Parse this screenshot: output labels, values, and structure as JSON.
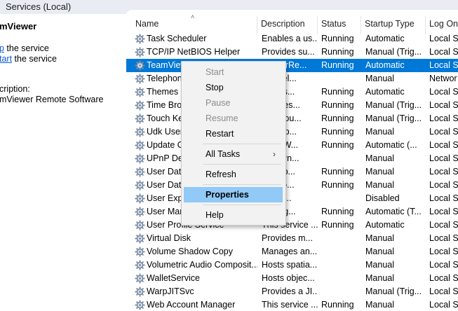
{
  "window": {
    "title": "Services (Local)"
  },
  "left_pane": {
    "service_name": "mViewer",
    "action_stop_link": "p",
    "action_stop_suffix": " the service",
    "action_restart_link": "tart",
    "action_restart_suffix": " the service",
    "description_label": "cription:",
    "description_text": "mViewer Remote Software"
  },
  "columns": {
    "name": "Name",
    "description": "Description",
    "status": "Status",
    "startup_type": "Startup Type",
    "log_on": "Log On"
  },
  "services": [
    {
      "name": "Task Scheduler",
      "description": "Enables a us...",
      "status": "Running",
      "startup": "Automatic",
      "logon": "Local Sy"
    },
    {
      "name": "TCP/IP NetBIOS Helper",
      "description": "Provides su...",
      "status": "Running",
      "startup": "Manual (Trig...",
      "logon": "Local Se"
    },
    {
      "name": "TeamViewer",
      "description": "ViewerRe...",
      "status": "Running",
      "startup": "Automatic",
      "logon": "Local Sy"
    },
    {
      "name": "Telephony",
      "description": "des Tel...",
      "status": "",
      "startup": "Manual",
      "logon": "Networ"
    },
    {
      "name": "Themes",
      "description": "des us...",
      "status": "Running",
      "startup": "Automatic",
      "logon": "Local Sy"
    },
    {
      "name": "Time Broker",
      "description": "rdinates...",
      "status": "Running",
      "startup": "Manual (Trig...",
      "logon": "Local Se"
    },
    {
      "name": "Touch Keyboard",
      "description": "bles Tou...",
      "status": "Running",
      "startup": "Manual (Trig...",
      "logon": "Local Sy"
    },
    {
      "name": "Udk User Service",
      "description": "ll comp...",
      "status": "Running",
      "startup": "Manual",
      "logon": "Local Sy"
    },
    {
      "name": "Update Orchestrator",
      "description": "ages W...",
      "status": "Running",
      "startup": "Automatic (...",
      "logon": "Local Sy"
    },
    {
      "name": "UPnP Device Host",
      "description": "ws UPn...",
      "status": "",
      "startup": "Manual",
      "logon": "Local Se"
    },
    {
      "name": "User Data Access",
      "description": "des ap...",
      "status": "Running",
      "startup": "Manual",
      "logon": "Local Sy"
    },
    {
      "name": "User Data Storage",
      "description": "les sto...",
      "status": "Running",
      "startup": "Manual",
      "logon": "Local Sy"
    },
    {
      "name": "User Experience",
      "description": "ort for...",
      "status": "",
      "startup": "Disabled",
      "logon": "Local Sy"
    },
    {
      "name": "User Manager",
      "description": "Manag...",
      "status": "Running",
      "startup": "Automatic (T...",
      "logon": "Local Sy"
    },
    {
      "name": "User Profile Service",
      "description": "This service ...",
      "status": "Running",
      "startup": "Automatic",
      "logon": "Local Sy"
    },
    {
      "name": "Virtual Disk",
      "description": "Provides m...",
      "status": "",
      "startup": "Manual",
      "logon": "Local Sy"
    },
    {
      "name": "Volume Shadow Copy",
      "description": "Manages an...",
      "status": "",
      "startup": "Manual",
      "logon": "Local Sy"
    },
    {
      "name": "Volumetric Audio Composit...",
      "description": "Hosts spatia...",
      "status": "",
      "startup": "Manual",
      "logon": "Local Se"
    },
    {
      "name": "WalletService",
      "description": "Hosts objec...",
      "status": "",
      "startup": "Manual",
      "logon": "Local Sy"
    },
    {
      "name": "WarpJITSvc",
      "description": "Provides a JI...",
      "status": "",
      "startup": "Manual (Trig...",
      "logon": "Local Se"
    },
    {
      "name": "Web Account Manager",
      "description": "This service ...",
      "status": "Running",
      "startup": "Manual",
      "logon": "Local Sy"
    }
  ],
  "context_menu": {
    "start": "Start",
    "stop": "Stop",
    "pause": "Pause",
    "resume": "Resume",
    "restart": "Restart",
    "all_tasks": "All Tasks",
    "refresh": "Refresh",
    "properties": "Properties",
    "help": "Help"
  },
  "icons": {
    "service": "gear-icon",
    "submenu": "chevron-right-icon",
    "sort": "chevron-up-icon"
  },
  "colors": {
    "selection": "#0078d7",
    "menu_highlight": "#91c9f7",
    "link": "#0b5bd0"
  }
}
